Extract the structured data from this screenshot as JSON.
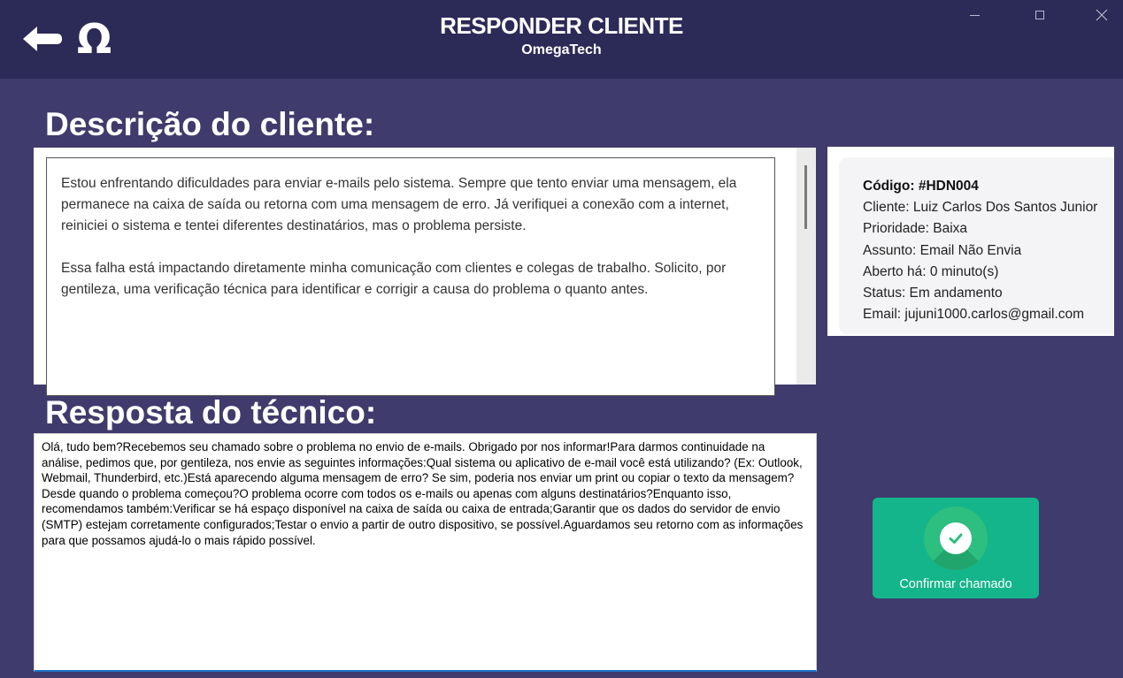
{
  "window": {
    "title": "RESPONDER CLIENTE",
    "subtitle": "OmegaTech",
    "logo_glyph": "Ω",
    "controls": [
      "minimize",
      "maximize",
      "close"
    ]
  },
  "description": {
    "heading": "Descrição do cliente:",
    "paragraphs": [
      "Estou enfrentando dificuldades para enviar e-mails pelo sistema. Sempre que tento enviar uma mensagem, ela permanece na caixa de saída ou retorna com uma mensagem de erro. Já verifiquei a conexão com a internet, reiniciei o sistema e tentei diferentes destinatários, mas o problema persiste.",
      "Essa falha está impactando diretamente minha comunicação com clientes e colegas de trabalho. Solicito, por gentileza, uma verificação técnica para identificar e corrigir a causa do problema o quanto antes."
    ]
  },
  "ticket": {
    "code": "Código: #HDN004",
    "client": "Cliente: Luiz Carlos Dos Santos Junior",
    "priority": "Prioridade: Baixa",
    "subject": "Assunto: Email Não Envia",
    "opened": "Aberto há: 0 minuto(s)",
    "status": "Status: Em andamento",
    "email": "Email: jujuni1000.carlos@gmail.com"
  },
  "response": {
    "heading": "Resposta do técnico:",
    "text": "Olá, tudo bem?Recebemos seu chamado sobre o problema no envio de e-mails. Obrigado por nos informar!Para darmos continuidade na análise, pedimos que, por gentileza, nos envie as seguintes informações:Qual sistema ou aplicativo de e-mail você está utilizando? (Ex: Outlook, Webmail, Thunderbird, etc.)Está aparecendo alguma mensagem de erro? Se sim, poderia nos enviar um print ou copiar o texto da mensagem?Desde quando o problema começou?O problema ocorre com todos os e-mails ou apenas com alguns destinatários?Enquanto isso, recomendamos também:Verificar se há espaço disponível na caixa de saída ou caixa de entrada;Garantir que os dados do servidor de envio (SMTP) estejam corretamente configurados;Testar o envio a partir de outro dispositivo, se possível.Aguardamos seu retorno com as informações para que possamos ajudá-lo o mais rápido possível."
  },
  "actions": {
    "confirm_label": "Confirmar chamado",
    "confirm_icon": "check-circle-icon"
  },
  "colors": {
    "background": "#3f3b6c",
    "titlebar": "#2c2a57",
    "confirm": "#14b58a",
    "focus_underline": "#1e6fc4"
  }
}
